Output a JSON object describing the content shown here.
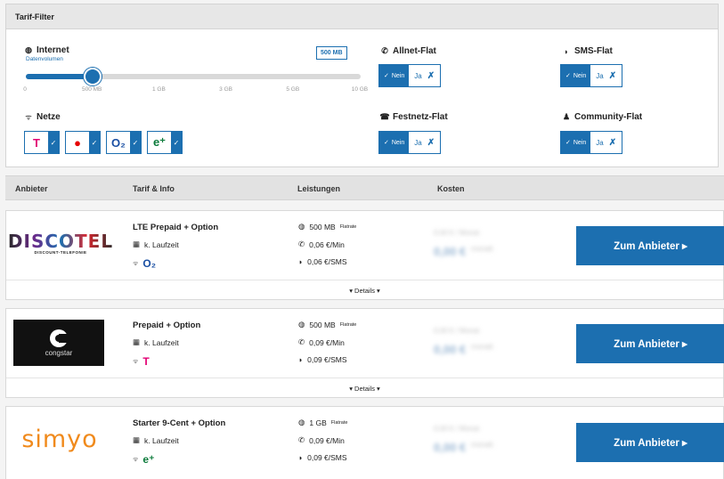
{
  "filter": {
    "title": "Tarif-Filter",
    "internet": {
      "label": "Internet",
      "sublabel": "Datenvolumen",
      "selected_volume": "500 MB",
      "slider_fraction": 0.2,
      "ticks": [
        "0",
        "500 MB",
        "1 GB",
        "3 GB",
        "5 GB",
        "10 GB"
      ]
    },
    "allnet": {
      "label": "Allnet-Flat",
      "nein": "Nein",
      "ja": "Ja"
    },
    "sms": {
      "label": "SMS-Flat",
      "nein": "Nein",
      "ja": "Ja"
    },
    "festnetz": {
      "label": "Festnetz-Flat",
      "nein": "Nein",
      "ja": "Ja"
    },
    "community": {
      "label": "Community-Flat",
      "nein": "Nein",
      "ja": "Ja"
    },
    "netze": {
      "label": "Netze",
      "networks": [
        {
          "logo": "T",
          "color": "#e20074"
        },
        {
          "logo": "●",
          "color": "#e60000"
        },
        {
          "logo": "O₂",
          "color": "#1a4fa3"
        },
        {
          "logo": "e⁺",
          "color": "#0a7a3a"
        }
      ]
    },
    "colors": {
      "accent": "#1c6fb0"
    }
  },
  "table": {
    "headers": [
      "Anbieter",
      "Tarif & Info",
      "Leistungen",
      "Kosten"
    ]
  },
  "rows": [
    {
      "provider": "DISCOTEL",
      "provider_sub": "DISCOUNT-TELEFONIE",
      "tarif": "LTE Prepaid + Option",
      "laufzeit": "k. Laufzeit",
      "network_logo": "O₂",
      "network_color": "#1a4fa3",
      "data": "500 MB",
      "data_note": "Flatrate",
      "minute": "0,06 €/Min",
      "sms": "0,06 €/SMS",
      "cost_label": "0,00 € / Monat",
      "cost_value": "0,00 €",
      "cost_unit": "monatl.",
      "cta": "Zum Anbieter ▸",
      "details": "▾ Details ▾"
    },
    {
      "provider": "congstar",
      "tarif": "Prepaid + Option",
      "laufzeit": "k. Laufzeit",
      "network_logo": "T",
      "network_color": "#e20074",
      "data": "500 MB",
      "data_note": "Flatrate",
      "minute": "0,09 €/Min",
      "sms": "0,09 €/SMS",
      "cost_label": "0,00 € / Monat",
      "cost_value": "0,00 €",
      "cost_unit": "monatl.",
      "cta": "Zum Anbieter ▸",
      "details": "▾ Details ▾"
    },
    {
      "provider": "simyo",
      "tarif": "Starter 9-Cent + Option",
      "laufzeit": "k. Laufzeit",
      "network_logo": "e⁺",
      "network_color": "#0a7a3a",
      "data": "1 GB",
      "data_note": "Flatrate",
      "minute": "0,09 €/Min",
      "sms": "0,09 €/SMS",
      "cost_label": "0,00 € / Monat",
      "cost_value": "0,00 €",
      "cost_unit": "monatl.",
      "cta": "Zum Anbieter ▸"
    }
  ]
}
